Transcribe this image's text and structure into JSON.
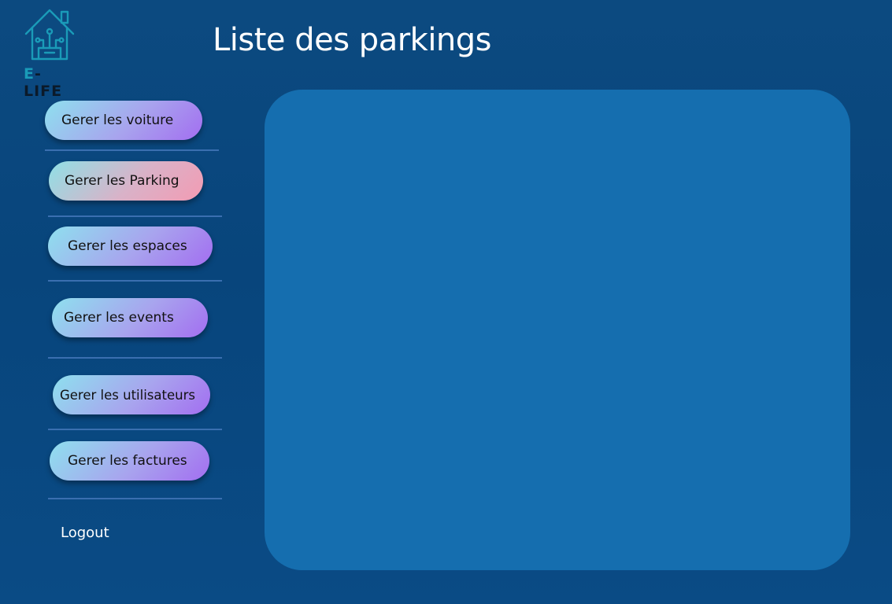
{
  "app": {
    "logo_text": "E-LIFE",
    "logo_text_prefix": "E",
    "logo_text_suffix": "-LIFE"
  },
  "header": {
    "title": "Liste des parkings"
  },
  "sidebar": {
    "items": [
      {
        "label": "Gerer les voiture",
        "active": false
      },
      {
        "label": "Gerer les Parking",
        "active": true
      },
      {
        "label": "Gerer les espaces",
        "active": false
      },
      {
        "label": "Gerer les events",
        "active": false
      },
      {
        "label": "Gerer les utilisateurs",
        "active": false
      },
      {
        "label": "Gerer les factures",
        "active": false
      }
    ],
    "logout_label": "Logout"
  },
  "colors": {
    "background": "#0b4a82",
    "panel": "#156eaf",
    "button_gradient_start": "#8ee0ee",
    "button_gradient_end": "#a36ef0",
    "active_gradient_end": "#f39bb3",
    "logo_teal": "#1a9bb8",
    "logo_dark": "#0b1a2a"
  },
  "icons": {
    "logo": "smart-house-icon"
  }
}
